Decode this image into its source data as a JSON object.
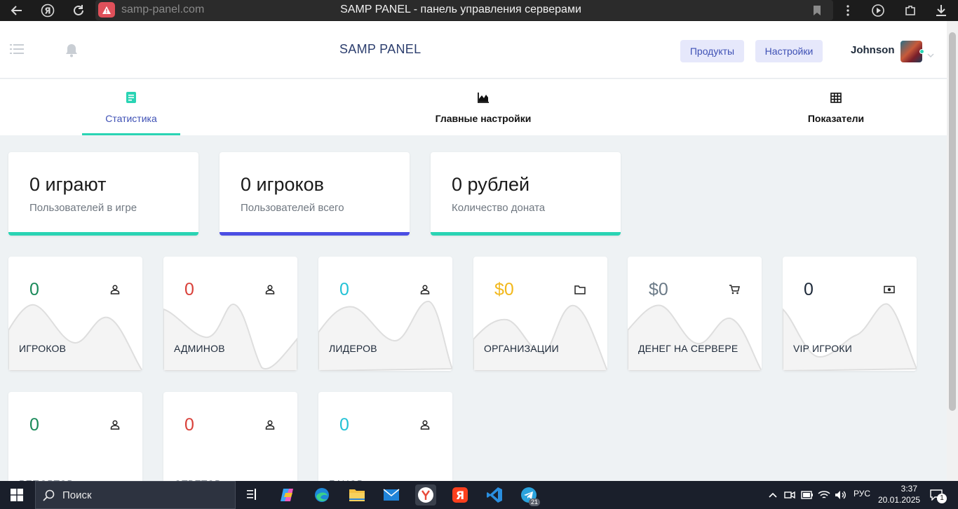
{
  "browser": {
    "url": "samp-panel.com",
    "page_title": "SAMP PANEL - панель управления серверами",
    "icons": [
      "back-arrow-icon",
      "yandex-logo-icon",
      "reload-icon",
      "warning-icon",
      "bookmark-icon",
      "more-vert-icon",
      "play-video-icon",
      "extensions-icon",
      "download-icon"
    ]
  },
  "header": {
    "brand": "SAMP PANEL",
    "products_label": "Продукты",
    "settings_label": "Настройки",
    "username": "Johnson"
  },
  "tabs": [
    {
      "label": "Статистика",
      "icon": "document-icon",
      "active": true
    },
    {
      "label": "Главные настройки",
      "icon": "area-chart-icon",
      "active": false
    },
    {
      "label": "Показатели",
      "icon": "table-grid-icon",
      "active": false
    }
  ],
  "stats": [
    {
      "value": "0 играют",
      "label": "Пользователей в игре",
      "color": "#2ad4b4"
    },
    {
      "value": "0 игроков",
      "label": "Пользователей всего",
      "color": "#4b4ee3"
    },
    {
      "value": "0 рублей",
      "label": "Количество доната",
      "color": "#2ad4b4"
    }
  ],
  "cards": [
    {
      "value": "0",
      "label": "ИГРОКОВ",
      "icon": "user-icon",
      "color": "#1a8a5a"
    },
    {
      "value": "0",
      "label": "АДМИНОВ",
      "icon": "user-icon",
      "color": "#d9413a"
    },
    {
      "value": "0",
      "label": "ЛИДЕРОВ",
      "icon": "user-icon",
      "color": "#23c2d6"
    },
    {
      "value": "$0",
      "label": "ОРГАНИЗАЦИИ",
      "icon": "folder-icon",
      "color": "#f2b81c"
    },
    {
      "value": "$0",
      "label": "ДЕНЕГ НА СЕРВЕРЕ",
      "icon": "cart-icon",
      "color": "#6b7a87"
    },
    {
      "value": "0",
      "label": "VIP ИГРОКИ",
      "icon": "money-icon",
      "color": "#1e2a3a"
    },
    {
      "value": "0",
      "label": "РЕПОРТОВ",
      "icon": "user-icon",
      "color": "#1a8a5a"
    },
    {
      "value": "0",
      "label": "ОТВЕТОВ",
      "icon": "user-icon",
      "color": "#d9413a"
    },
    {
      "value": "0",
      "label": "БАНОВ",
      "icon": "user-icon",
      "color": "#23c2d6"
    }
  ],
  "taskbar": {
    "search_label": "Поиск",
    "lang": "РУС",
    "time": "3:37",
    "date": "20.01.2025",
    "telegram_badge": "21",
    "notification_count": "1"
  }
}
